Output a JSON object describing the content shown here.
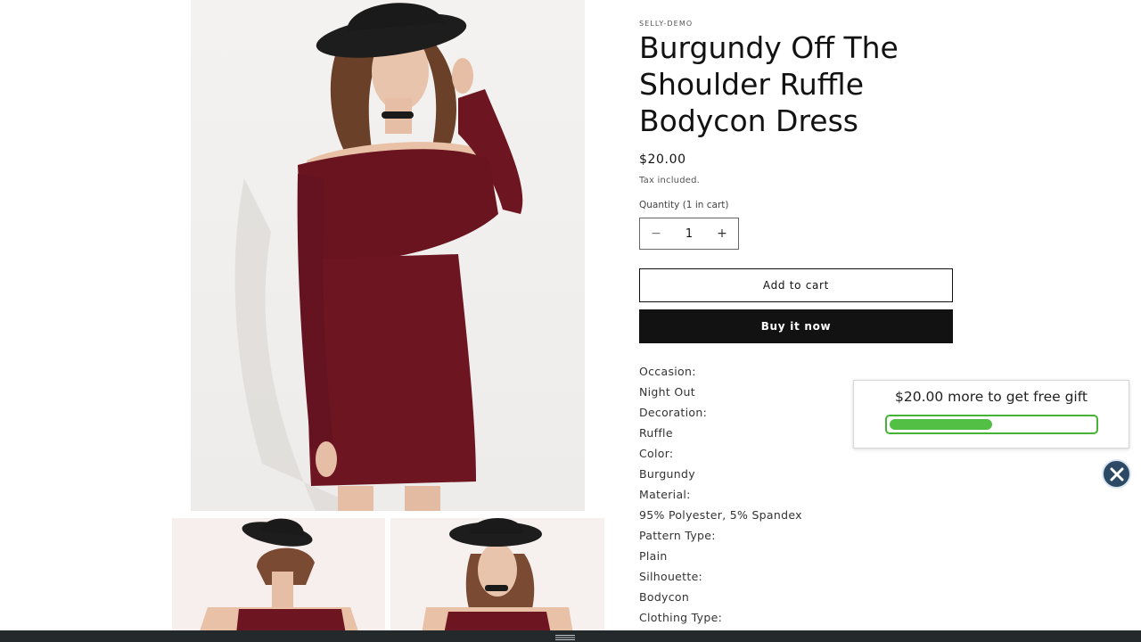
{
  "product": {
    "vendor": "SELLY-DEMO",
    "title": "Burgundy Off The Shoulder Ruffle Bodycon Dress",
    "price": "$20.00",
    "tax_note": "Tax included.",
    "quantity_label": "Quantity (1 in cart)",
    "quantity_value": "1",
    "minus_symbol": "−",
    "plus_symbol": "+",
    "add_to_cart_label": "Add to cart",
    "buy_now_label": "Buy it now",
    "description": [
      "Occasion:",
      "Night Out",
      "Decoration:",
      "Ruffle",
      "Color:",
      "Burgundy",
      "Material:",
      "95% Polyester, 5% Spandex",
      "Pattern Type:",
      "Plain",
      "Silhouette:",
      "Bodycon",
      "Clothing Type:"
    ]
  },
  "gift_popup": {
    "message": "$20.00 more to get free gift",
    "progress_percent": 50,
    "bar_color": "#53bf45",
    "border_color": "#45b336"
  },
  "icons": {
    "close": "close-icon",
    "handle": "drag-handle-icon"
  },
  "colors": {
    "dress": "#6e1522",
    "buy_button": "#121212",
    "close_button": "#2c4a66",
    "bottom_bar": "#242a2c"
  }
}
